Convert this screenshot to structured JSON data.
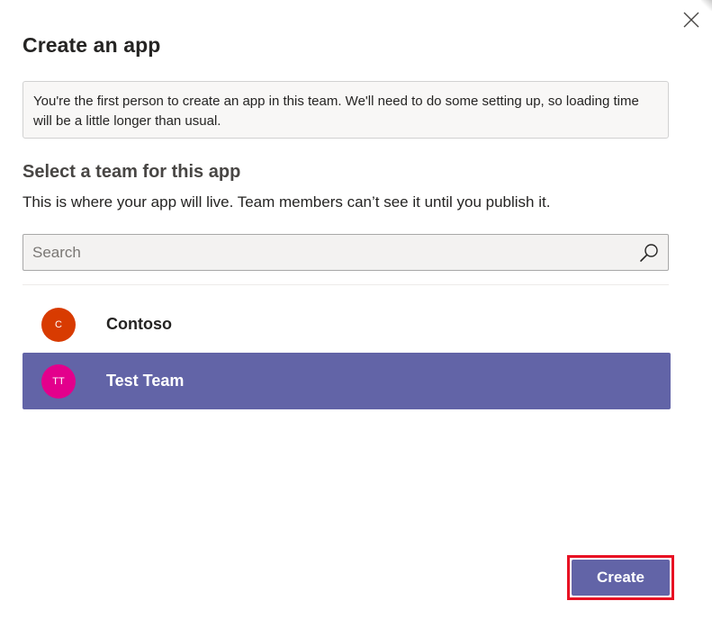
{
  "dialog": {
    "title": "Create an app",
    "close_icon": "close-icon"
  },
  "info": {
    "message": "You're the first person to create an app in this team. We'll need to do some setting up, so loading time will be a little longer than usual."
  },
  "team_section": {
    "title": "Select a team for this app",
    "description": "This is where your app will live. Team members can’t see it until you publish it."
  },
  "search": {
    "placeholder": "Search",
    "value": "",
    "icon": "search-icon"
  },
  "teams": [
    {
      "initials": "C",
      "name": "Contoso",
      "avatar_color": "#d83b01",
      "selected": false
    },
    {
      "initials": "TT",
      "name": "Test Team",
      "avatar_color": "#e3008c",
      "selected": true
    }
  ],
  "actions": {
    "create_label": "Create"
  },
  "colors": {
    "accent": "#6264a7",
    "highlight_border": "#e81123"
  }
}
